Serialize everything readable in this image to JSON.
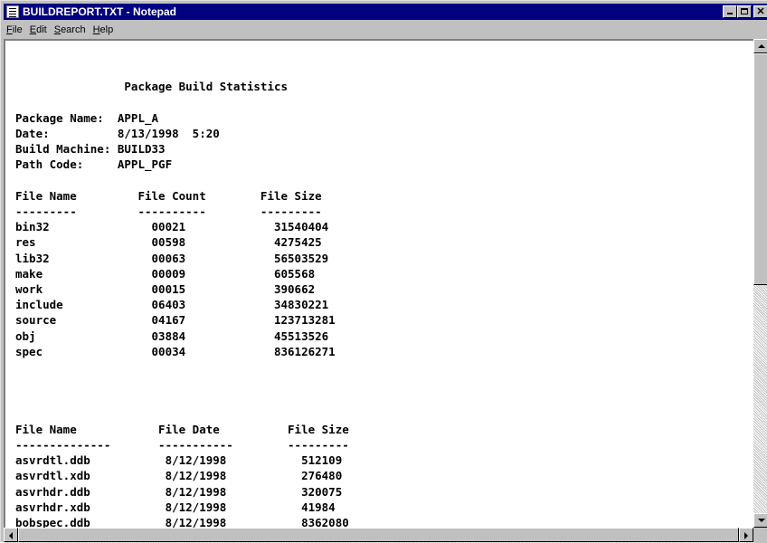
{
  "window": {
    "title": "BUILDREPORT.TXT - Notepad",
    "icon": "notepad-icon"
  },
  "menu": [
    {
      "underline": "F",
      "rest": "ile"
    },
    {
      "underline": "E",
      "rest": "dit"
    },
    {
      "underline": "S",
      "rest": "earch"
    },
    {
      "underline": "H",
      "rest": "elp"
    }
  ],
  "document": {
    "text": "\n\n                Package Build Statistics\n\nPackage Name:  APPL_A\nDate:          8/13/1998  5:20\nBuild Machine: BUILD33\nPath Code:     APPL_PGF\n\nFile Name         File Count        File Size\n---------         ----------        ---------\nbin32               00021             31540404\nres                 00598             4275425\nlib32               00063             56503529\nmake                00009             605568\nwork                00015             390662\ninclude             06403             34830221\nsource              04167             123713281\nobj                 03884             45513526\nspec                00034             836126271\n\n\n\n\nFile Name            File Date          File Size\n--------------       -----------        ---------\nasvrdtl.ddb           8/12/1998           512109\nasvrdtl.xdb           8/12/1998           276480\nasvrhdr.ddb           8/12/1998           320075\nasvrhdr.xdb           8/12/1998           41984\nbobspec.ddb           8/12/1998           8362080"
  }
}
